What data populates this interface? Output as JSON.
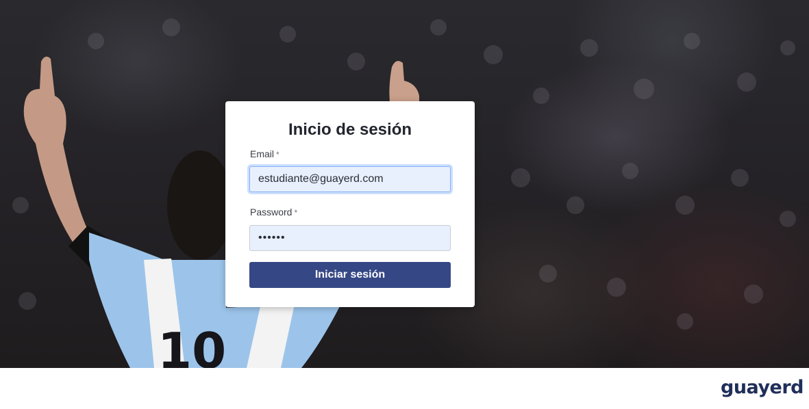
{
  "login": {
    "title": "Inicio de sesión",
    "email_label": "Email",
    "email_required_mark": "*",
    "email_value": "estudiante@guayerd.com",
    "password_label": "Password",
    "password_required_mark": "*",
    "password_value": "••••••",
    "submit_label": "Iniciar sesión"
  },
  "hero": {
    "jersey_number": "10"
  },
  "brand": {
    "logo_text": "guayerd"
  },
  "colors": {
    "primary_button": "#364785",
    "input_autofill_bg": "#e8f0fe",
    "logo": "#1f2f5a"
  }
}
